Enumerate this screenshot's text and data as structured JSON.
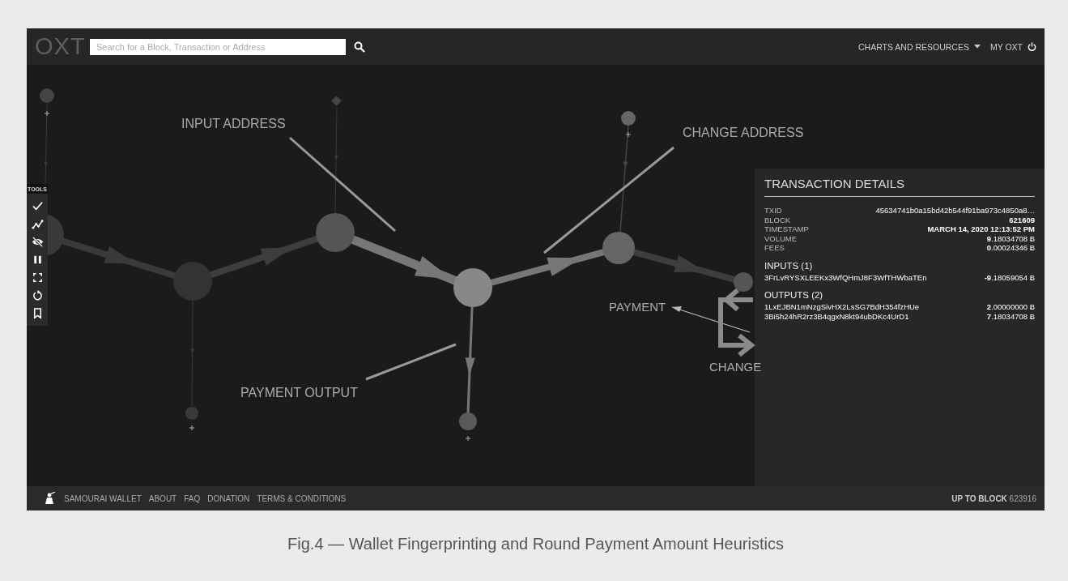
{
  "header": {
    "logo": "OXT",
    "search": {
      "placeholder": "Search for a Block, Transaction or Address"
    },
    "nav": [
      {
        "label": "CHARTS AND RESOURCES",
        "kind": "dropdown"
      },
      {
        "label": "MY OXT",
        "kind": "power"
      }
    ]
  },
  "tools": {
    "title": "TOOLS"
  },
  "annotations": [
    {
      "text": "INPUT ADDRESS"
    },
    {
      "text": "CHANGE ADDRESS"
    },
    {
      "text": "PAYMENT OUTPUT"
    },
    {
      "text": "PAYMENT"
    },
    {
      "text": "CHANGE"
    }
  ],
  "transaction_details": {
    "title": "TRANSACTION DETAILS",
    "fields": [
      {
        "label": "TXID",
        "value": "45634741b0a15bd42b544f91ba973c4850a8…",
        "emphasis": false
      },
      {
        "label": "BLOCK",
        "value": "621609",
        "emphasis": true
      },
      {
        "label": "TIMESTAMP",
        "value": "MARCH 14, 2020 12:13:52 PM",
        "emphasis": true
      },
      {
        "label": "VOLUME",
        "value": "**9**.18034708 Ƀ",
        "emphasis": false
      },
      {
        "label": "FEES",
        "value": "**0**.00024346 Ƀ",
        "emphasis": false
      }
    ],
    "inputs": {
      "title": "INPUTS (1)",
      "rows": [
        {
          "address": "3FrLvRYSXLEEKx3WfQHmJ8F3WfTHWbaTEn",
          "amount": "**-9**.18059054 Ƀ"
        }
      ]
    },
    "outputs": {
      "title": "OUTPUTS (2)",
      "rows": [
        {
          "address": "1LxEJBN1mNzgSivHX2LsSG7BdH354fzHUe",
          "amount": "**2**.00000000 Ƀ"
        },
        {
          "address": "3Bi5h24hR2rz3B4qgxN8kt94ubDKc4UrD1",
          "amount": "**7**.18034708 Ƀ"
        }
      ]
    }
  },
  "footer": {
    "links": [
      "SAMOURAI WALLET",
      "ABOUT",
      "FAQ",
      "DONATION",
      "TERMS & CONDITIONS"
    ],
    "block": "**UP TO BLOCK** 623916"
  },
  "caption": "Fig.4 — Wallet Fingerprinting and Round Payment Amount Heuristics"
}
